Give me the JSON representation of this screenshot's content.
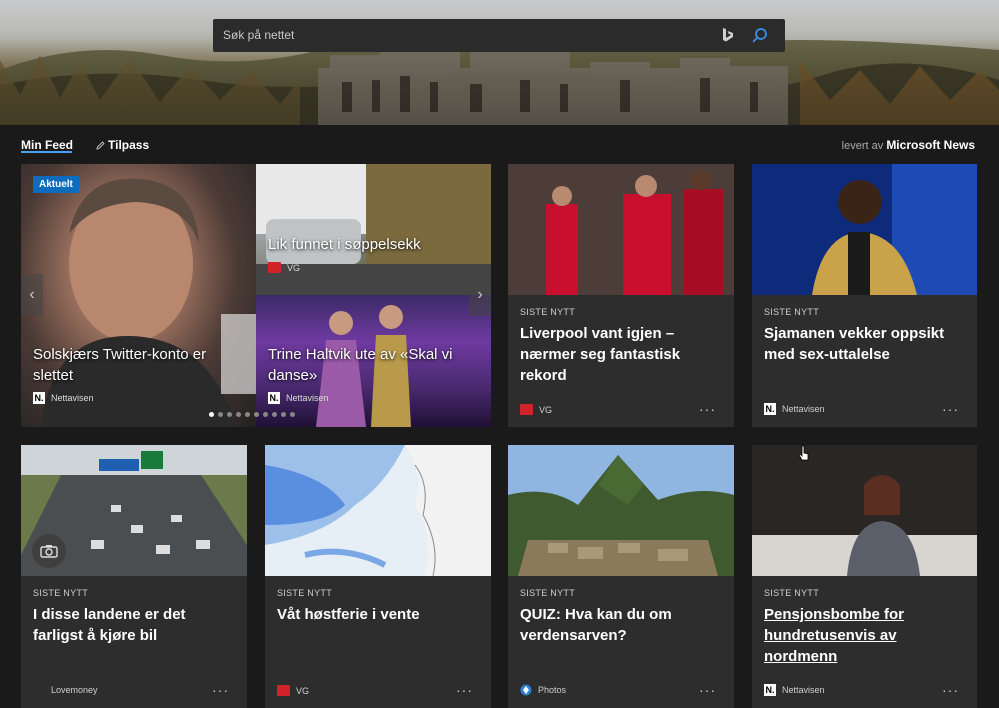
{
  "search": {
    "placeholder": "Søk på nettet"
  },
  "feed": {
    "tabs": [
      "Min Feed",
      "Tilpass"
    ],
    "powered_prefix": "levert av",
    "powered_brand": "Microsoft News"
  },
  "carousel": {
    "badge": "Aktuelt",
    "left": {
      "headline": "Solskjærs Twitter-konto er slettet",
      "source": "Nettavisen"
    },
    "right_top": {
      "headline": "Lik funnet i søppelsekk",
      "source": "VG"
    },
    "right_bottom": {
      "headline": "Trine Haltvik ute av «Skal vi danse»",
      "source": "Nettavisen"
    },
    "page_count": 10,
    "active_page": 1
  },
  "cards": [
    {
      "category": "SISTE NYTT",
      "headline": "Liverpool vant igjen – nærmer seg fantastisk rekord",
      "source": "VG",
      "source_logo": "vg-logo"
    },
    {
      "category": "SISTE NYTT",
      "headline": "Sjamanen vekker oppsikt med sex-uttalelse",
      "source": "Nettavisen",
      "source_logo": "nettavisen-logo"
    },
    {
      "category": "SISTE NYTT",
      "headline": "I disse landene er det farligst å kjøre bil",
      "source": "Lovemoney",
      "source_logo": "none"
    },
    {
      "category": "SISTE NYTT",
      "headline": "Våt høstferie i vente",
      "source": "VG",
      "source_logo": "vg-logo"
    },
    {
      "category": "SISTE NYTT",
      "headline": "QUIZ: Hva kan du om verdensarven?",
      "source": "Photos",
      "source_logo": "photos-logo"
    },
    {
      "category": "SISTE NYTT",
      "headline": "Pensjonsbombe for hundretusenvis av nordmenn",
      "source": "Nettavisen",
      "source_logo": "nettavisen-logo"
    }
  ],
  "more_label": "···",
  "colors": {
    "accent": "#0f6cbd",
    "underline": "#4aa0f0",
    "vg": "#d2232a",
    "card": "#2d2d2d",
    "background": "#1a1a1a"
  }
}
